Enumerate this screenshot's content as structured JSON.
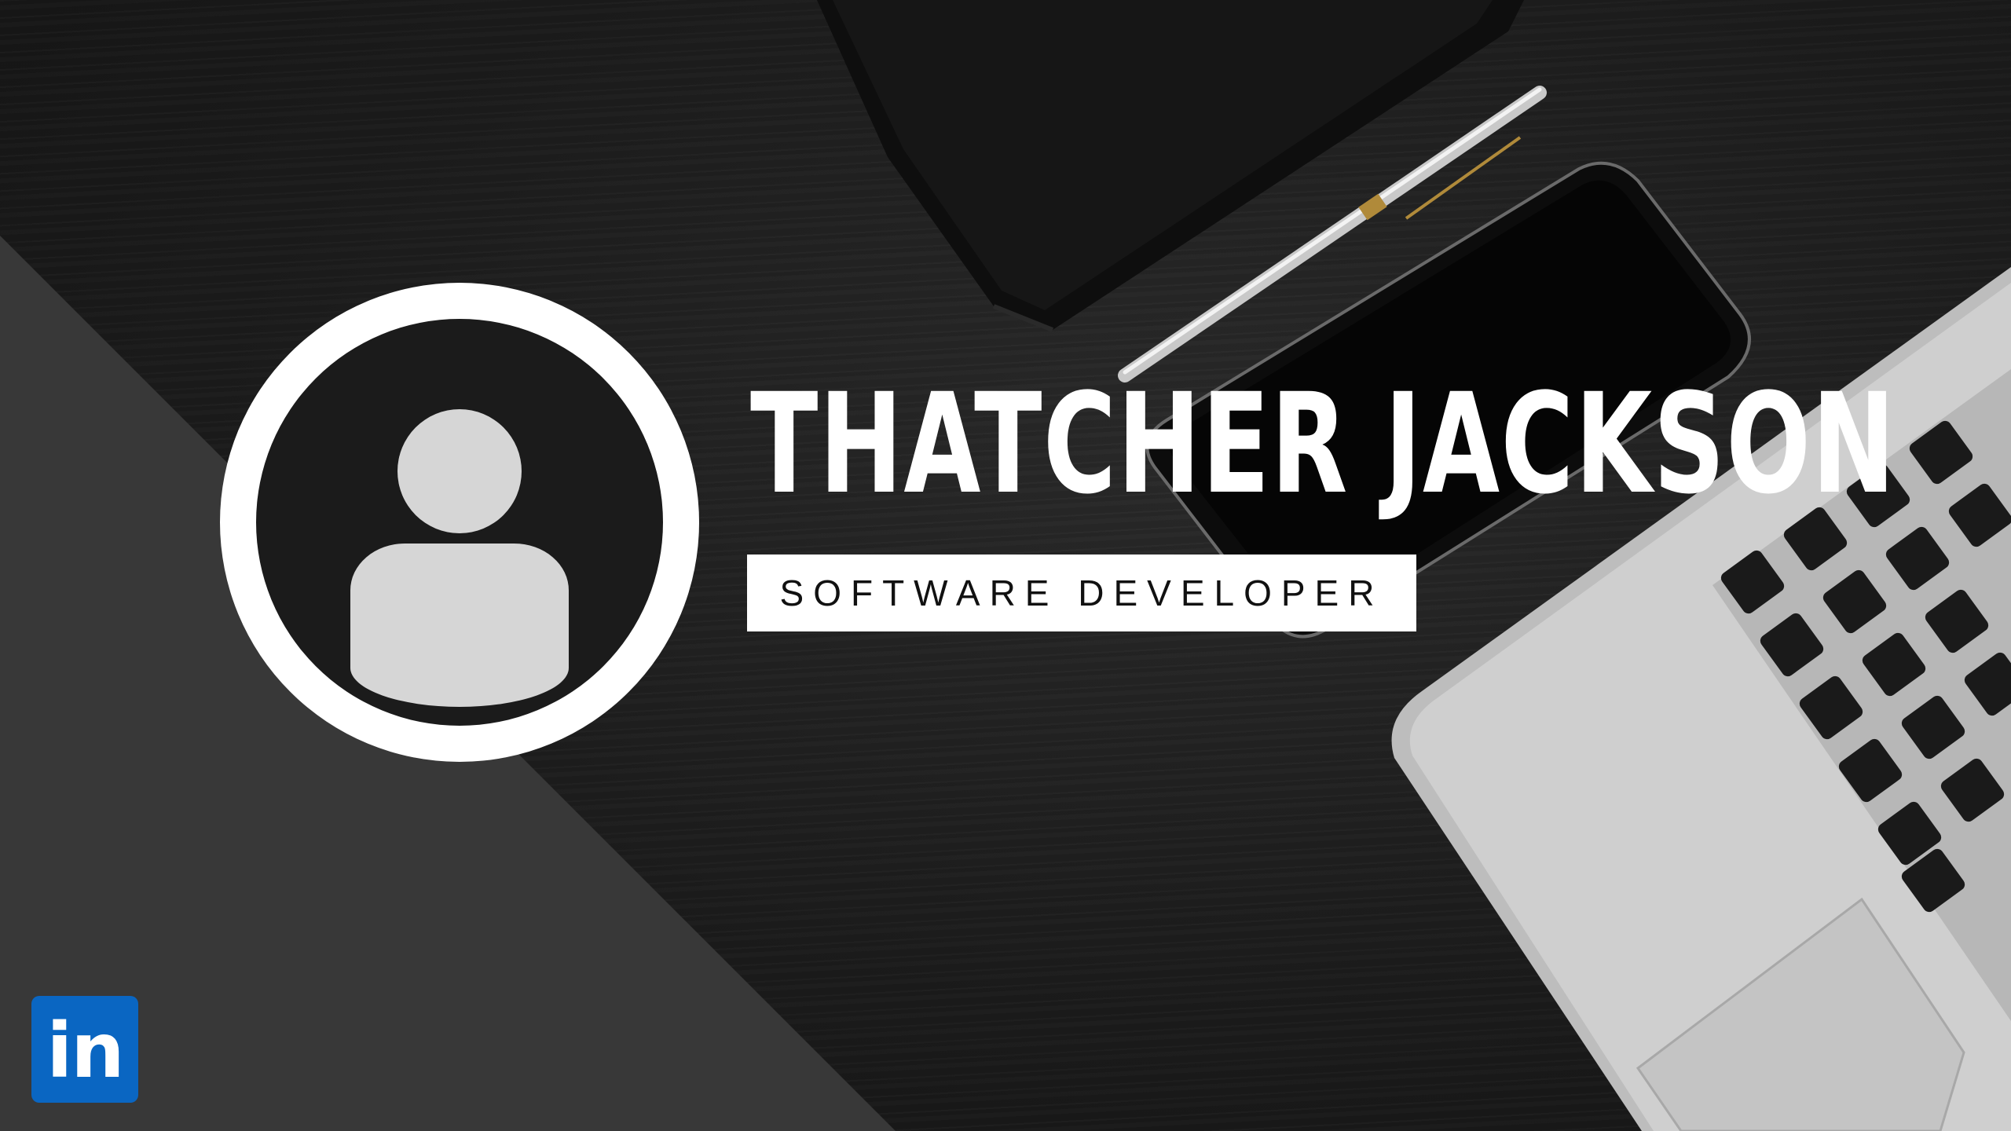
{
  "banner": {
    "name": "THATCHER JACKSON",
    "role": "SOFTWARE DEVELOPER",
    "linkedin_label": "in"
  },
  "colors": {
    "background": "#1c1c1c",
    "panel": "#383838",
    "accent_white": "#ffffff",
    "avatar_fill": "#d6d6d6",
    "linkedin_blue": "#0a66c2"
  },
  "icons": {
    "avatar": "user-silhouette-icon",
    "social": "linkedin-icon"
  }
}
